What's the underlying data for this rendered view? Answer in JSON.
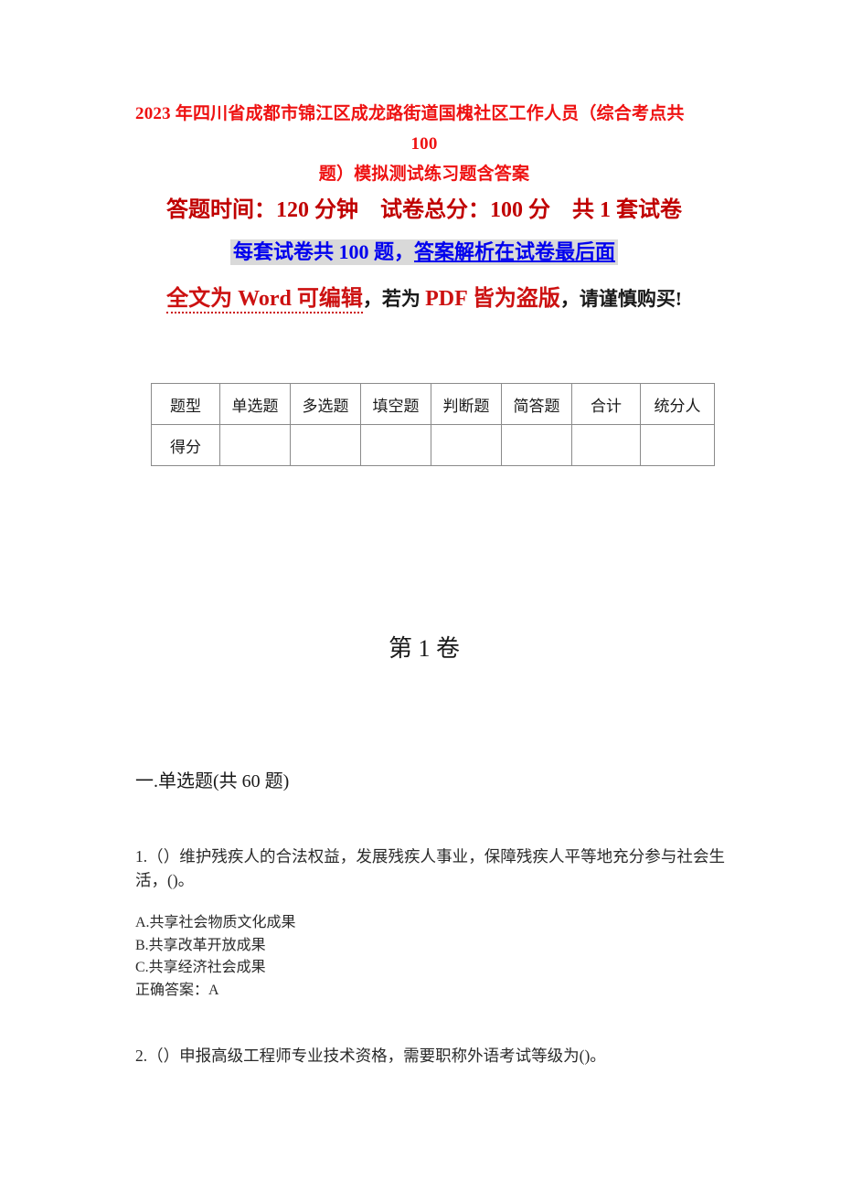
{
  "document": {
    "title_line1": "2023 年四川省成都市锦江区成龙路街道国槐社区工作人员（综合考点共 100",
    "title_line2": "题）模拟测试练习题含答案",
    "title_color": "#ee1111"
  },
  "exam_info": {
    "line1": "答题时间：120 分钟    试卷总分：100 分    共 1 套试卷",
    "line1_color": "#c00000",
    "line2_plain": "每套试卷共 100 题，",
    "line2_underlined": "答案解析在试卷最后面",
    "line2_color": "#0000ee",
    "line2_highlight": "#d9d9d9",
    "line3_red_dotted": "全文为 Word 可编辑",
    "line3_sep1": "，若为 ",
    "line3_red_bold": "PDF 皆为盗版",
    "line3_tail": "，请谨慎购买",
    "line3_tail2": "!",
    "line3_red": "#cc1111"
  },
  "score_table": {
    "headers": [
      "题型",
      "单选题",
      "多选题",
      "填空题",
      "判断题",
      "简答题",
      "合计",
      "统分人"
    ],
    "rows": [
      {
        "label": "得分",
        "cells": [
          "",
          "",
          "",
          "",
          "",
          "",
          ""
        ]
      }
    ]
  },
  "volume": {
    "label": "第 1 卷"
  },
  "section": {
    "heading": "一.单选题(共 60 题)"
  },
  "questions": [
    {
      "stem": "1.（）维护残疾人的合法权益，发展残疾人事业，保障残疾人平等地充分参与社会生活，()。",
      "options": [
        "A.共享社会物质文化成果",
        "B.共享改革开放成果",
        "C.共享经济社会成果"
      ],
      "answer": "正确答案：A"
    },
    {
      "stem": "2.（）申报高级工程师专业技术资格，需要职称外语考试等级为()。",
      "options": [],
      "answer": ""
    }
  ]
}
